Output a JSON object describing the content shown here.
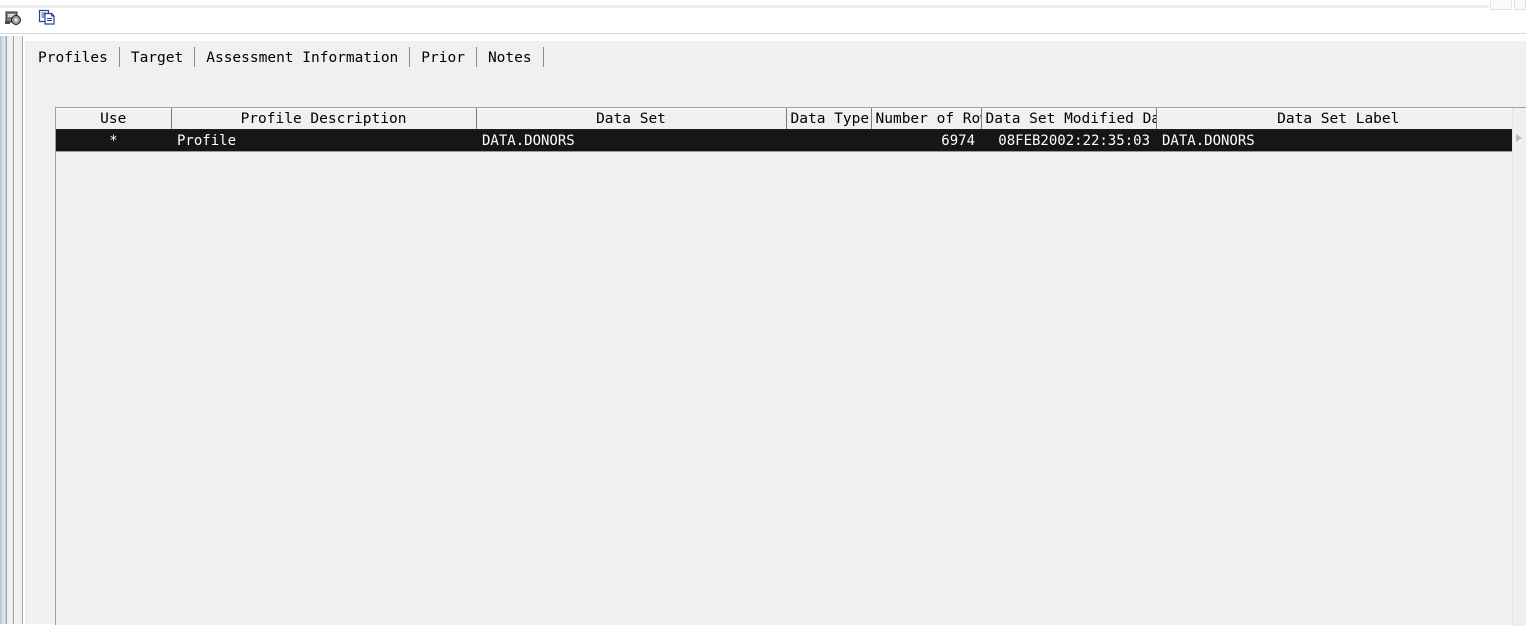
{
  "toolbar": {
    "buttons": [
      {
        "name": "run-icon",
        "label": "Run"
      },
      {
        "name": "copy-icon",
        "label": "Copy"
      }
    ]
  },
  "window_controls": [
    {
      "name": "restore-button",
      "label": ""
    },
    {
      "name": "close-button",
      "label": ""
    }
  ],
  "tabs": [
    {
      "label": "Profiles",
      "selected": true
    },
    {
      "label": "Target",
      "selected": false
    },
    {
      "label": "Assessment Information",
      "selected": false
    },
    {
      "label": "Prior",
      "selected": false
    },
    {
      "label": "Notes",
      "selected": false
    }
  ],
  "grid": {
    "columns": [
      {
        "key": "use",
        "label": "Use"
      },
      {
        "key": "profile_description",
        "label": "Profile Description"
      },
      {
        "key": "data_set",
        "label": "Data Set"
      },
      {
        "key": "data_type",
        "label": "Data Type"
      },
      {
        "key": "number_of_rows",
        "label": "Number of Rows"
      },
      {
        "key": "data_set_modified_date",
        "label": "Data Set Modified Date"
      },
      {
        "key": "data_set_label",
        "label": "Data Set Label"
      }
    ],
    "rows": [
      {
        "use": "*",
        "profile_description": "Profile",
        "data_set": "DATA.DONORS",
        "data_type": "",
        "number_of_rows": "6974",
        "data_set_modified_date": "08FEB2002:22:35:03",
        "data_set_label": "DATA.DONORS",
        "selected": true
      }
    ]
  },
  "colors": {
    "panel_bg": "#f0f0f0",
    "selection_bg": "#161616",
    "selection_fg": "#ffffff",
    "grid_line": "#7d7d7d",
    "icon_blue": "#2a3f9d"
  }
}
